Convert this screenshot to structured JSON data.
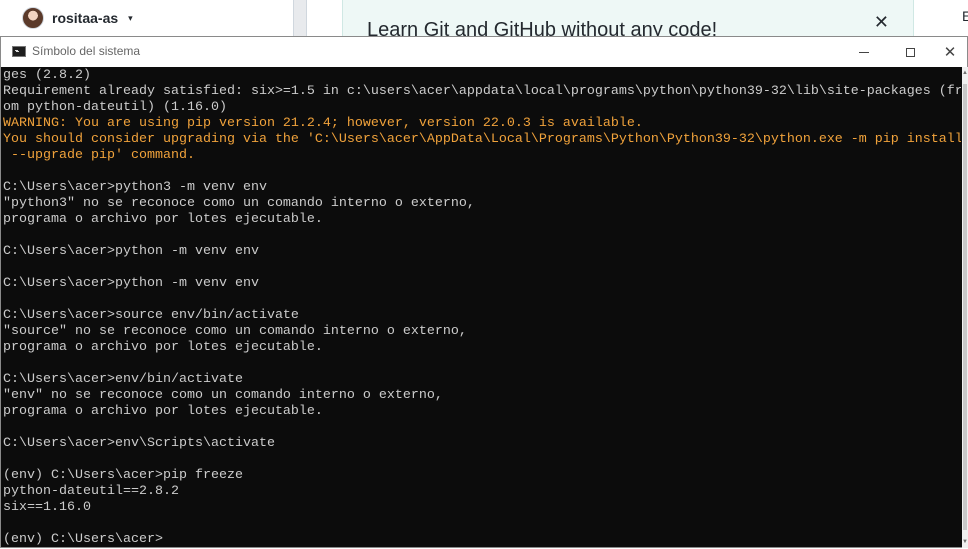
{
  "background": {
    "user": {
      "name": "rositaa-as",
      "avatar": "avatar-icon",
      "caret": "▾"
    },
    "banner": {
      "text": "Learn Git and GitHub without any code!",
      "close": "✕"
    },
    "right_text": "E"
  },
  "window": {
    "title": "Símbolo del sistema",
    "icon": "cmd-icon",
    "controls": {
      "minimize": "minimize-icon",
      "maximize": "maximize-icon",
      "close": "close-icon"
    }
  },
  "console": {
    "lines": [
      {
        "text": "ges (2.8.2)",
        "type": "normal"
      },
      {
        "text": "Requirement already satisfied: six>=1.5 in c:\\users\\acer\\appdata\\local\\programs\\python\\python39-32\\lib\\site-packages (fr",
        "type": "normal"
      },
      {
        "text": "om python-dateutil) (1.16.0)",
        "type": "normal"
      },
      {
        "text": "WARNING: You are using pip version 21.2.4; however, version 22.0.3 is available.",
        "type": "warn"
      },
      {
        "text": "You should consider upgrading via the 'C:\\Users\\acer\\AppData\\Local\\Programs\\Python\\Python39-32\\python.exe -m pip install",
        "type": "warn"
      },
      {
        "text": " --upgrade pip' command.",
        "type": "warn"
      },
      {
        "text": "",
        "type": "normal"
      },
      {
        "text": "C:\\Users\\acer>python3 -m venv env",
        "type": "normal"
      },
      {
        "text": "\"python3\" no se reconoce como un comando interno o externo,",
        "type": "normal"
      },
      {
        "text": "programa o archivo por lotes ejecutable.",
        "type": "normal"
      },
      {
        "text": "",
        "type": "normal"
      },
      {
        "text": "C:\\Users\\acer>python -m venv env",
        "type": "normal"
      },
      {
        "text": "",
        "type": "normal"
      },
      {
        "text": "C:\\Users\\acer>python -m venv env",
        "type": "normal"
      },
      {
        "text": "",
        "type": "normal"
      },
      {
        "text": "C:\\Users\\acer>source env/bin/activate",
        "type": "normal"
      },
      {
        "text": "\"source\" no se reconoce como un comando interno o externo,",
        "type": "normal"
      },
      {
        "text": "programa o archivo por lotes ejecutable.",
        "type": "normal"
      },
      {
        "text": "",
        "type": "normal"
      },
      {
        "text": "C:\\Users\\acer>env/bin/activate",
        "type": "normal"
      },
      {
        "text": "\"env\" no se reconoce como un comando interno o externo,",
        "type": "normal"
      },
      {
        "text": "programa o archivo por lotes ejecutable.",
        "type": "normal"
      },
      {
        "text": "",
        "type": "normal"
      },
      {
        "text": "C:\\Users\\acer>env\\Scripts\\activate",
        "type": "normal"
      },
      {
        "text": "",
        "type": "normal"
      },
      {
        "text": "(env) C:\\Users\\acer>pip freeze",
        "type": "normal"
      },
      {
        "text": "python-dateutil==2.8.2",
        "type": "normal"
      },
      {
        "text": "six==1.16.0",
        "type": "normal"
      },
      {
        "text": "",
        "type": "normal"
      },
      {
        "text": "(env) C:\\Users\\acer>",
        "type": "normal"
      }
    ]
  },
  "colors": {
    "console_bg": "#0c0c0c",
    "console_text": "#cccccc",
    "warning": "#f0a23b"
  }
}
